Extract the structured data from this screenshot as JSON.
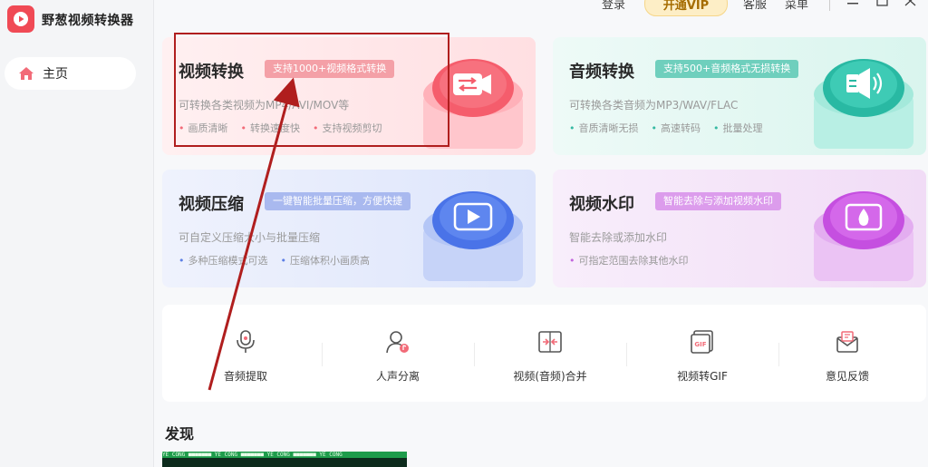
{
  "app": {
    "title": "野葱视频转换器"
  },
  "sidebar": {
    "items": [
      {
        "label": "主页"
      }
    ]
  },
  "topbar": {
    "login": "登录",
    "vip": "开通VIP",
    "service": "客服",
    "menu": "菜单"
  },
  "cards": [
    {
      "title": "视频转换",
      "badge": "支持1000+视频格式转换",
      "desc": "可转换各类视频为MP4/AVI/MOV等",
      "bullets": [
        "画质清晰",
        "转换速度快",
        "支持视频剪切"
      ]
    },
    {
      "title": "音频转换",
      "badge": "支持500+音频格式无损转换",
      "desc": "可转换各类音频为MP3/WAV/FLAC",
      "bullets": [
        "音质清晰无损",
        "高速转码",
        "批量处理"
      ]
    },
    {
      "title": "视频压缩",
      "badge": "一键智能批量压缩，方便快捷",
      "desc": "可自定义压缩大小与批量压缩",
      "bullets": [
        "多种压缩模式可选",
        "压缩体积小画质高"
      ]
    },
    {
      "title": "视频水印",
      "badge": "智能去除与添加视频水印",
      "desc": "智能去除或添加水印",
      "bullets": [
        "可指定范围去除其他水印"
      ]
    }
  ],
  "tools": [
    {
      "label": "音频提取",
      "icon": "microphone-icon"
    },
    {
      "label": "人声分离",
      "icon": "voice-separation-icon"
    },
    {
      "label": "视频(音频)合并",
      "icon": "merge-icon"
    },
    {
      "label": "视频转GIF",
      "icon": "gif-icon"
    },
    {
      "label": "意见反馈",
      "icon": "feedback-icon"
    }
  ],
  "discover": {
    "title": "发现",
    "thumb_text": "YE CONG ■■■■■■■   YE CONG ■■■■■■■   YE CONG ■■■■■■■   YE CONG"
  },
  "colors": {
    "accent": "#f04a55",
    "annotation": "#b01e1e",
    "video": "#f26b78",
    "audio": "#35b9a2",
    "compress": "#5d7fe5",
    "watermark": "#c266dd"
  }
}
